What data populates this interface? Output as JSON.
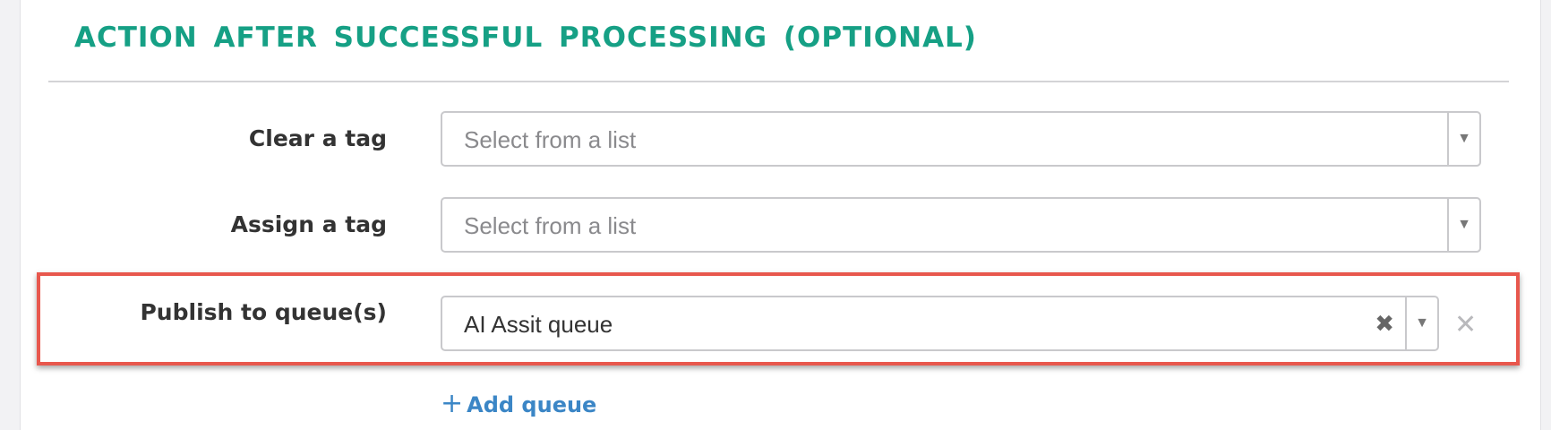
{
  "section": {
    "title": "ACTION AFTER SUCCESSFUL PROCESSING (OPTIONAL)"
  },
  "fields": {
    "clear_tag": {
      "label": "Clear a tag",
      "placeholder": "Select from a list"
    },
    "assign_tag": {
      "label": "Assign a tag",
      "placeholder": "Select from a list"
    },
    "publish_queue": {
      "label": "Publish to queue(s)",
      "value": "AI Assit queue"
    }
  },
  "add_queue": {
    "plus": "+",
    "label": "Add queue"
  },
  "icons": {
    "dropdown": "chevron-down-icon",
    "clear": "close-icon",
    "remove": "close-icon"
  },
  "colors": {
    "title": "#16a085",
    "link": "#3b86c6",
    "highlight": "#e8574d"
  }
}
